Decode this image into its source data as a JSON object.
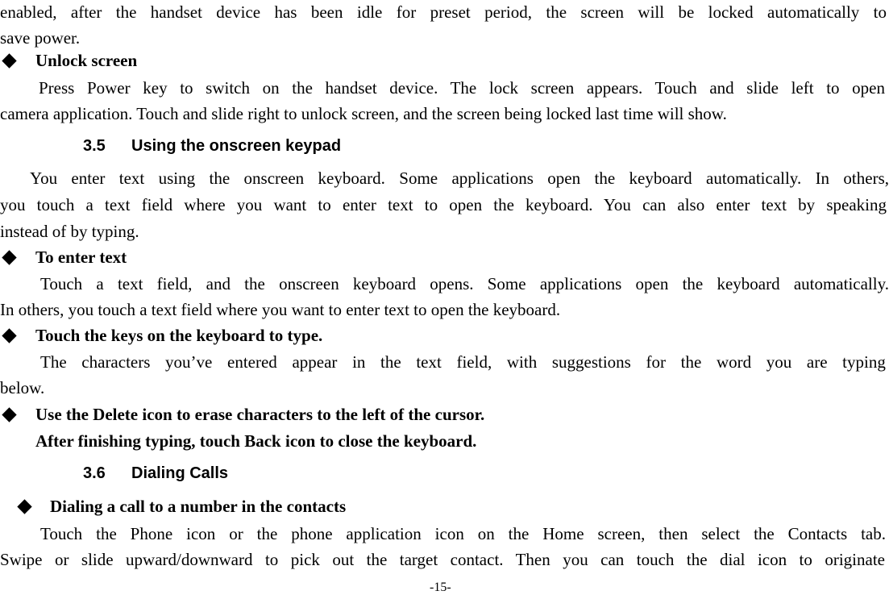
{
  "page": {
    "number": "-15-"
  },
  "intro": {
    "line1": "enabled, after the handset device has been idle for preset period, the screen will be locked automatically to",
    "line2": "save power."
  },
  "unlock_screen": {
    "title": "Unlock screen",
    "line1": "Press Power key to switch on the handset device. The lock screen appears. Touch and slide left to open",
    "line2": "camera application. Touch and slide right to unlock screen, and the screen being locked last time will show."
  },
  "section_3_5": {
    "number": "3.5",
    "title": "Using the onscreen keypad",
    "para_line1": "You enter text using the onscreen keyboard. Some applications open the keyboard automatically. In others,",
    "para_line2": "you touch a text field where you want to enter text to open the keyboard. You can also enter text by speaking",
    "para_line3": "instead of by typing."
  },
  "to_enter_text": {
    "title": "To enter text",
    "line1": "Touch a text field, and the onscreen keyboard opens. Some applications open the keyboard automatically.",
    "line2": "In others, you touch a text field where you want to enter text to open the keyboard."
  },
  "touch_keys": {
    "title": "Touch the keys on the keyboard to type.",
    "line1_words": [
      "The",
      "characters",
      "you’ve",
      "entered",
      "appear",
      "in",
      "the",
      "text",
      "field,",
      "with",
      "suggestions",
      "for",
      "the",
      "word",
      "you",
      "are",
      "typing"
    ],
    "line2": "below."
  },
  "delete_icon": {
    "title": "Use the Delete icon to erase characters to the left of the cursor.",
    "line2": "After finishing typing, touch Back icon to close the keyboard."
  },
  "section_3_6": {
    "number": "3.6",
    "title": "Dialing Calls"
  },
  "dialing_contacts": {
    "title": "Dialing a call to a number in the contacts",
    "line1": "Touch the Phone icon or the phone application icon on the Home screen, then select the Contacts tab.",
    "line2": "Swipe or slide upward/downward to pick out the target contact. Then you can touch the dial icon to originate"
  }
}
